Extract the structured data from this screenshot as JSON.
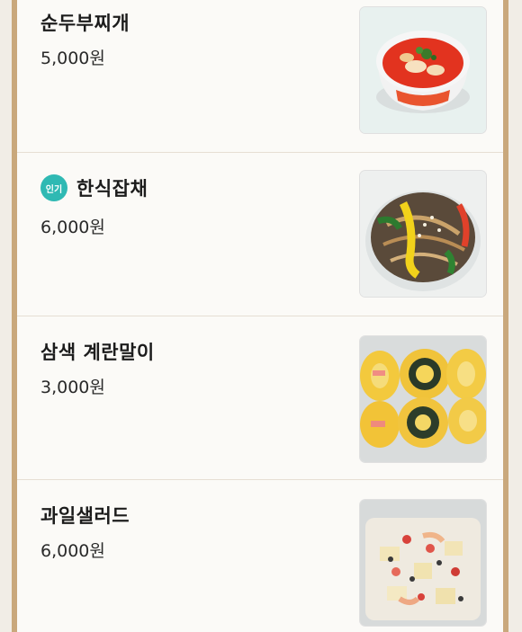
{
  "menu": {
    "items": [
      {
        "name": "순두부찌개",
        "price": "5,000원",
        "badge": "",
        "image": "soft-tofu-stew-image"
      },
      {
        "name": "한식잡채",
        "price": "6,000원",
        "badge": "인기",
        "image": "japchae-image"
      },
      {
        "name": "삼색 계란말이",
        "price": "3,000원",
        "badge": "",
        "image": "rolled-omelette-image"
      },
      {
        "name": "과일샐러드",
        "price": "6,000원",
        "badge": "",
        "image": "fruit-salad-image"
      }
    ]
  },
  "colors": {
    "frame": "#c9a87c",
    "panel": "#fbfaf7",
    "badge": "#2fb9b3"
  }
}
